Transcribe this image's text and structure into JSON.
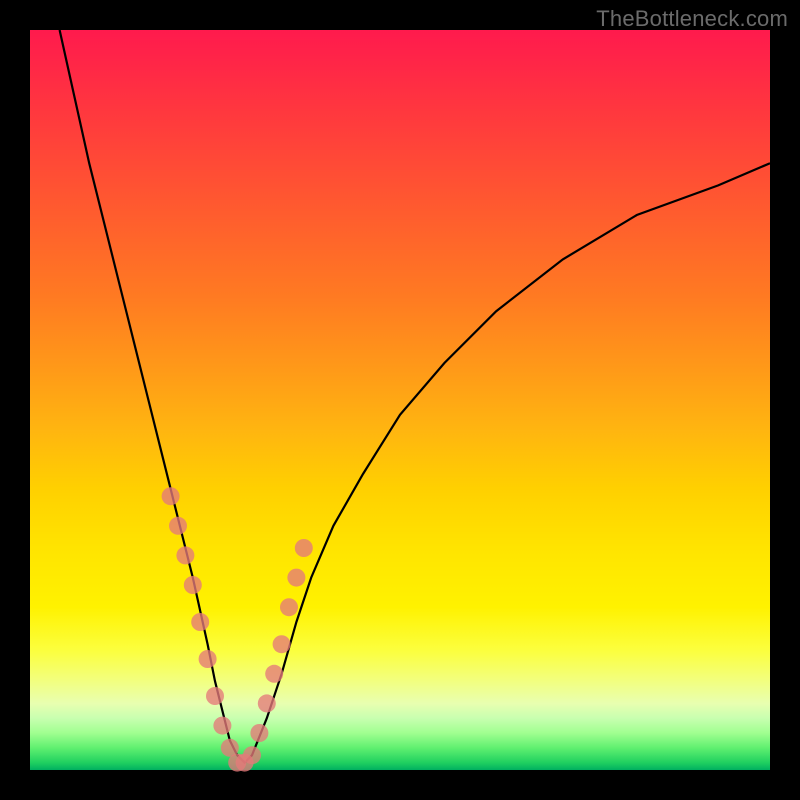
{
  "watermark": "TheBottleneck.com",
  "colors": {
    "frame": "#000000",
    "curve": "#000000",
    "marker": "#e47a7a",
    "gradient_top": "#ff1a4d",
    "gradient_bottom": "#00b060"
  },
  "chart_data": {
    "type": "line",
    "title": "",
    "xlabel": "",
    "ylabel": "",
    "xlim": [
      0,
      100
    ],
    "ylim": [
      0,
      100
    ],
    "grid": false,
    "legend": false,
    "series": [
      {
        "name": "bottleneck-curve",
        "x": [
          4,
          6,
          8,
          10,
          12,
          14,
          16,
          18,
          20,
          22,
          24,
          25,
          26,
          27,
          28,
          29,
          30,
          32,
          34,
          36,
          38,
          41,
          45,
          50,
          56,
          63,
          72,
          82,
          93,
          100
        ],
        "y": [
          100,
          91,
          82,
          74,
          66,
          58,
          50,
          42,
          34,
          26,
          17,
          12,
          8,
          4,
          2,
          1,
          2,
          7,
          13,
          20,
          26,
          33,
          40,
          48,
          55,
          62,
          69,
          75,
          79,
          82
        ]
      }
    ],
    "markers": {
      "name": "highlighted-points",
      "x": [
        19,
        20,
        21,
        22,
        23,
        24,
        25,
        26,
        27,
        28,
        29,
        30,
        31,
        32,
        33,
        34,
        35,
        36,
        37
      ],
      "y": [
        37,
        33,
        29,
        25,
        20,
        15,
        10,
        6,
        3,
        1,
        1,
        2,
        5,
        9,
        13,
        17,
        22,
        26,
        30
      ]
    }
  }
}
